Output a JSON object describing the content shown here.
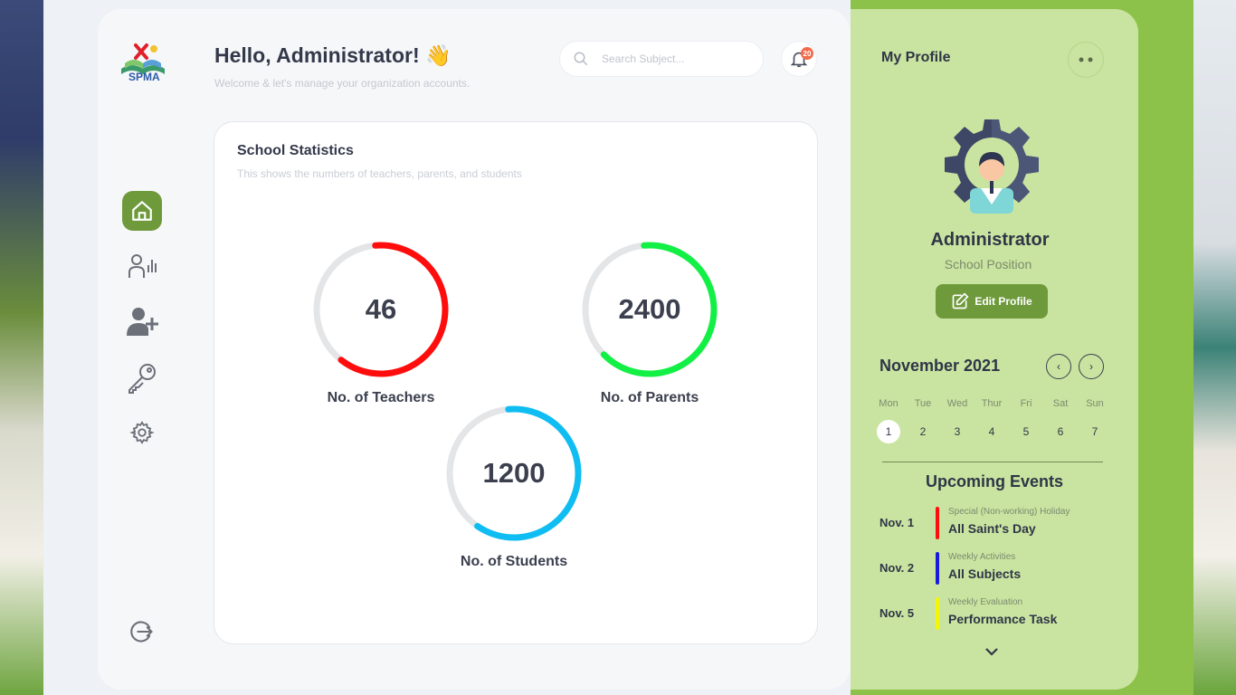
{
  "app": {
    "logo_text": "SPMA"
  },
  "header": {
    "greeting": "Hello, Administrator! 👋",
    "subtitle": "Welcome & let's manage your organization accounts.",
    "search_placeholder": "Search Subject...",
    "notification_count": "20"
  },
  "sidebar": {
    "items": [
      {
        "icon": "home-icon",
        "active": true
      },
      {
        "icon": "user-stats-icon",
        "active": false
      },
      {
        "icon": "add-user-icon",
        "active": false
      },
      {
        "icon": "key-icon",
        "active": false
      },
      {
        "icon": "gear-icon",
        "active": false
      }
    ],
    "logout_icon": "logout-icon"
  },
  "stats": {
    "title": "School Statistics",
    "subtitle": "This shows the numbers of teachers, parents, and students",
    "items": [
      {
        "value": "46",
        "label": "No. of Teachers",
        "color": "#ff0d0d",
        "fraction": 0.62
      },
      {
        "value": "2400",
        "label": "No. of Parents",
        "color": "#12f045",
        "fraction": 0.64
      },
      {
        "value": "1200",
        "label": "No. of Students",
        "color": "#0fbdf2",
        "fraction": 0.61
      }
    ]
  },
  "profile": {
    "title": "My Profile",
    "name": "Administrator",
    "position": "School Position",
    "edit_label": "Edit Profile"
  },
  "calendar": {
    "month": "November 2021",
    "weekdays": [
      "Mon",
      "Tue",
      "Wed",
      "Thur",
      "Fri",
      "Sat",
      "Sun"
    ],
    "days": [
      "1",
      "2",
      "3",
      "4",
      "5",
      "6",
      "7"
    ],
    "selected": "1"
  },
  "events": {
    "title": "Upcoming Events",
    "items": [
      {
        "date": "Nov. 1",
        "category": "Special (Non-working) Holiday",
        "name": "All Saint's Day",
        "color": "#ff0d0d"
      },
      {
        "date": "Nov. 2",
        "category": "Weekly Activities",
        "name": "All Subjects",
        "color": "#1a1adb"
      },
      {
        "date": "Nov. 5",
        "category": "Weekly Evaluation",
        "name": "Performance Task",
        "color": "#f5f50a"
      }
    ]
  },
  "colors": {
    "accent": "#6f9a3c",
    "panel": "#c9e4a0",
    "app_green": "#8cc24a"
  }
}
